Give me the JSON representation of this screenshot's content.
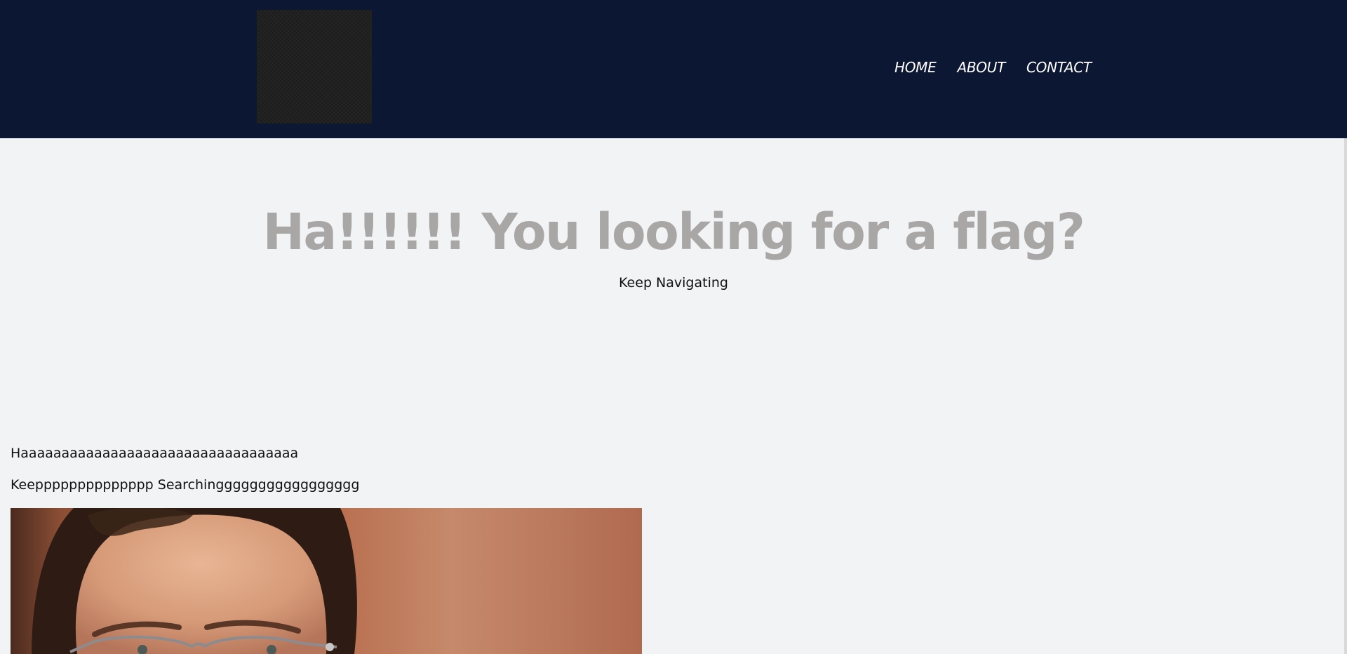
{
  "header": {
    "nav": [
      {
        "label": "HOME"
      },
      {
        "label": "ABOUT"
      },
      {
        "label": "CONTACT"
      }
    ]
  },
  "hero": {
    "title": "Ha!!!!!! You looking for a flag?",
    "subtitle": "Keep Navigating"
  },
  "content": {
    "paragraph1": "Haaaaaaaaaaaaaaaaaaaaaaaaaaaaaaaaaa",
    "paragraph2": "Keepppppppppppppp Searchinggggggggggggggggg"
  },
  "colors": {
    "header_bg": "#0c1733",
    "page_bg": "#f2f3f5",
    "title_color": "#a9a6a6"
  }
}
